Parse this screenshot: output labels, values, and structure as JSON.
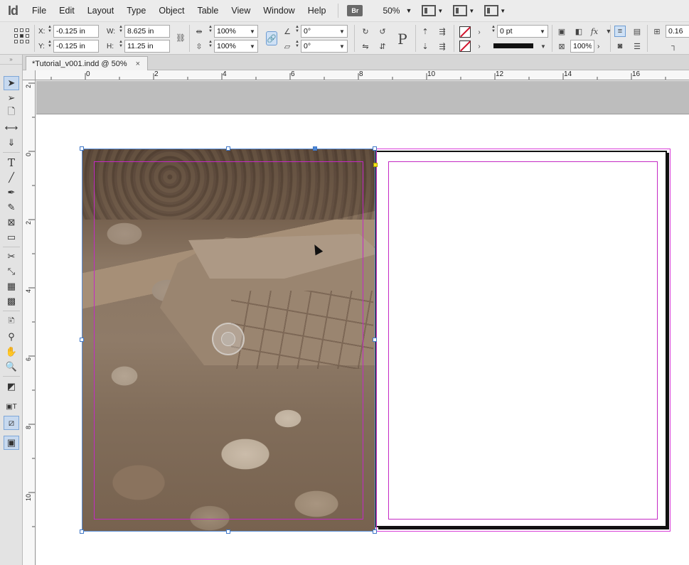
{
  "app": {
    "logo": "Id"
  },
  "menu": {
    "items": [
      "File",
      "Edit",
      "Layout",
      "Type",
      "Object",
      "Table",
      "View",
      "Window",
      "Help"
    ],
    "bridge_label": "Br",
    "zoom_value": "50%"
  },
  "control_panel": {
    "x_label": "X:",
    "x_value": "-0.125 in",
    "y_label": "Y:",
    "y_value": "-0.125 in",
    "w_label": "W:",
    "w_value": "8.625 in",
    "h_label": "H:",
    "h_value": "11.25 in",
    "scale_x": "100%",
    "scale_y": "100%",
    "rotation": "0°",
    "shear": "0°",
    "stroke_weight": "0 pt",
    "opacity": "100%",
    "partial_value": "0.16"
  },
  "document_tab": {
    "title": "*Tutorial_v001.indd @ 50%",
    "close_glyph": "×"
  },
  "rulers": {
    "horizontal_labels": [
      "0",
      "2",
      "4",
      "6",
      "8",
      "10",
      "12",
      "14",
      "16"
    ],
    "vertical_labels": [
      "2",
      "0",
      "2",
      "4",
      "6",
      "8",
      "10"
    ]
  },
  "colors": {
    "selection": "#5b8ed6",
    "margin_guide": "#c42ac4",
    "stroke_swatch_slash": "#d0102a",
    "active_tool_bg": "#c7d9ef"
  },
  "tools": {
    "list": [
      "selection-tool",
      "direct-selection-tool",
      "page-tool",
      "gap-tool",
      "content-collector-tool",
      "type-tool",
      "line-tool",
      "pen-tool",
      "pencil-tool",
      "rectangle-frame-tool",
      "rectangle-tool",
      "scissors-tool",
      "free-transform-tool",
      "gradient-swatch-tool",
      "gradient-feather-tool",
      "note-tool",
      "eyedropper-tool",
      "hand-tool",
      "zoom-tool"
    ]
  }
}
